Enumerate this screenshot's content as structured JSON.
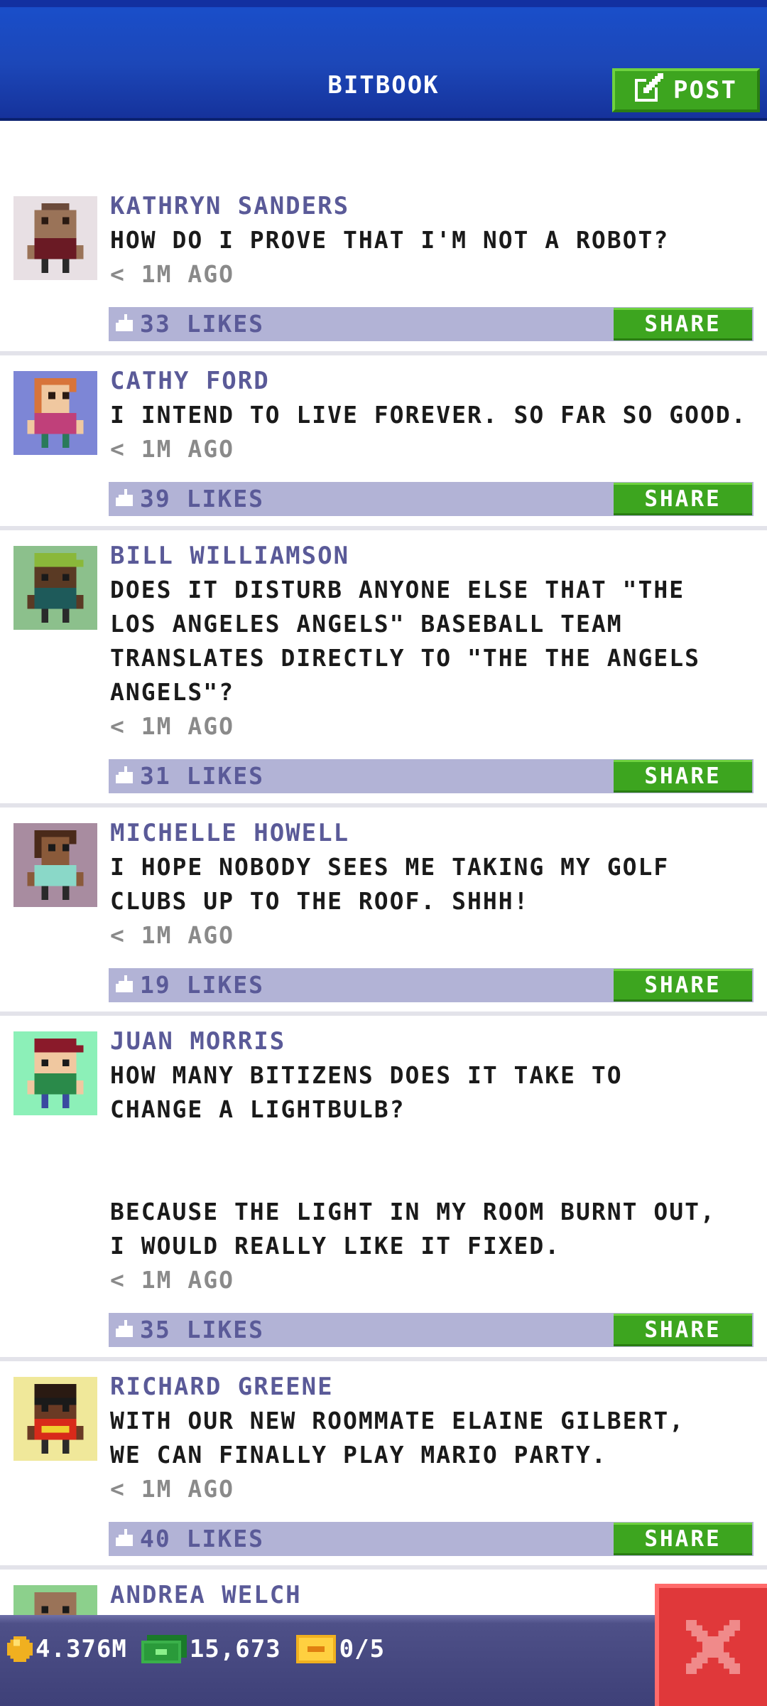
{
  "header": {
    "title": "BITBOOK",
    "post_label": "POST"
  },
  "posts": [
    {
      "author": "KATHRYN SANDERS",
      "message": "HOW DO I PROVE THAT I'M NOT A ROBOT?",
      "time": "< 1M AGO",
      "likes": "33 LIKES",
      "share": "SHARE"
    },
    {
      "author": "CATHY FORD",
      "message": "I INTEND TO LIVE FOREVER. SO FAR SO GOOD.",
      "time": "< 1M AGO",
      "likes": "39 LIKES",
      "share": "SHARE"
    },
    {
      "author": "BILL WILLIAMSON",
      "message": "DOES IT DISTURB ANYONE ELSE THAT \"THE\nLOS ANGELES ANGELS\" BASEBALL TEAM\nTRANSLATES DIRECTLY TO \"THE THE ANGELS\nANGELS\"?",
      "time": "< 1M AGO",
      "likes": "31 LIKES",
      "share": "SHARE"
    },
    {
      "author": "MICHELLE HOWELL",
      "message": "I HOPE NOBODY SEES ME TAKING MY GOLF\nCLUBS UP TO THE ROOF. SHHH!",
      "time": "< 1M AGO",
      "likes": "19 LIKES",
      "share": "SHARE"
    },
    {
      "author": "JUAN MORRIS",
      "message": "HOW MANY BITIZENS DOES IT TAKE TO\nCHANGE A LIGHTBULB?\n\n\nBECAUSE THE LIGHT IN MY ROOM BURNT OUT,\nI WOULD REALLY LIKE IT FIXED.",
      "time": "< 1M AGO",
      "likes": "35 LIKES",
      "share": "SHARE"
    },
    {
      "author": "RICHARD GREENE",
      "message": "WITH OUR NEW ROOMMATE ELAINE GILBERT,\nWE CAN FINALLY PLAY MARIO PARTY.",
      "time": "< 1M AGO",
      "likes": "40 LIKES",
      "share": "SHARE"
    },
    {
      "author": "ANDREA WELCH"
    }
  ],
  "footer": {
    "coins": "4.376M",
    "bux": "15,673",
    "tickets": "0/5"
  },
  "colors": {
    "header_blue": "#1c47b8",
    "share_green": "#3da51f",
    "like_bar": "#b2b3d6",
    "close_red": "#e0383a",
    "author_purple": "#5a5a98"
  },
  "icons": [
    "edit-icon",
    "thumbs-up-icon",
    "coin-icon",
    "bux-icon",
    "ticket-icon",
    "close-icon"
  ]
}
